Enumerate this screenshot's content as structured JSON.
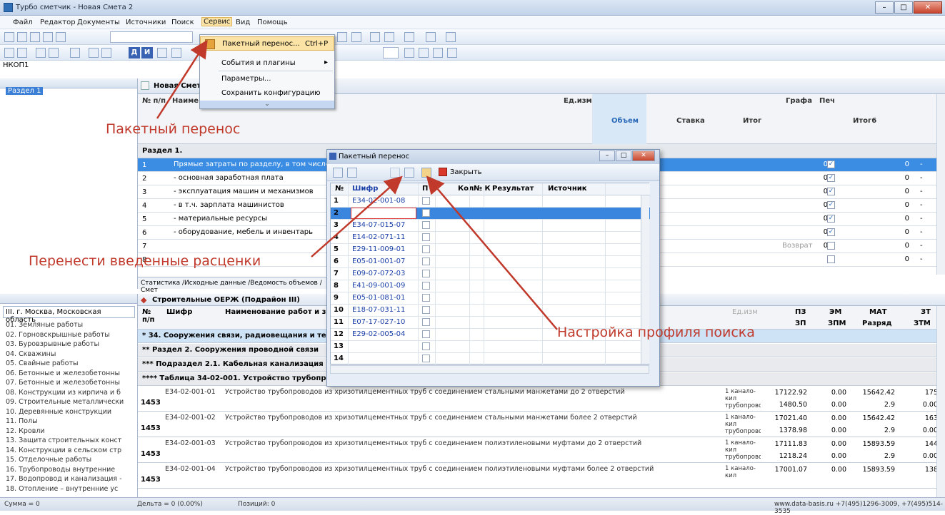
{
  "window": {
    "title": "Турбо сметчик - Новая Смета 2"
  },
  "menu": [
    "Файл",
    "Редактор",
    "Документы",
    "Источники",
    "Поиск",
    "Сервис",
    "Вид",
    "Помощь"
  ],
  "hkof": "НКОП1",
  "tree_top": {
    "selected": "Раздел 1"
  },
  "dropdown": {
    "items": [
      {
        "label": "Пакетный перенос...",
        "shortcut": "Ctrl+P"
      },
      {
        "label": "События и плагины"
      },
      {
        "label": "Параметры..."
      },
      {
        "label": "Сохранить конфигурацию"
      }
    ],
    "expand_glyph": "⌄"
  },
  "estimate": {
    "tab": "Новая Смета",
    "headers": {
      "np": "№ п/п",
      "name": "Наиме",
      "unit": "Ед.изм.",
      "volume": "Объем",
      "rate": "Ставка",
      "total": "Итог",
      "grafa": "Графа",
      "pech": "Печ",
      "total6": "Итог6"
    },
    "section": "Раздел 1.",
    "rows": [
      {
        "n": "1",
        "text": "Прямые затраты по разделу, в том числе:",
        "v": "0",
        "chk": "✓",
        "v2": "0",
        "d": "-",
        "sel": true
      },
      {
        "n": "2",
        "text": "- основная заработная плата",
        "v": "0",
        "chk": "✓",
        "v2": "0",
        "d": "-"
      },
      {
        "n": "3",
        "text": "- эксплуатация машин и механизмов",
        "v": "0",
        "chk": "✓",
        "v2": "0",
        "d": "-"
      },
      {
        "n": "4",
        "text": "- в т.ч. зарплата машинистов",
        "v": "0",
        "chk": "✓",
        "v2": "0",
        "d": "-"
      },
      {
        "n": "5",
        "text": "- материальные ресурсы",
        "v": "0",
        "chk": "✓",
        "v2": "0",
        "d": "-"
      },
      {
        "n": "6",
        "text": "- оборудование, мебель и инвентарь",
        "v": "0",
        "chk": "✓",
        "v2": "0",
        "d": "-"
      },
      {
        "n": "7",
        "text": "",
        "v": "0",
        "vextra": "Возврат",
        "chk": "",
        "v2": "0",
        "d": "-"
      },
      {
        "n": "8",
        "text": "",
        "v": "",
        "chk": "",
        "v2": "0",
        "d": "-"
      }
    ],
    "bottom_tabs": "Статистика /Исходные данные /Ведомость объемов /Смет"
  },
  "norms": {
    "region": "III. г. Москва, Московская область",
    "tree": [
      "01. Земляные работы",
      "02. Горновскрышные работы",
      "03. Буровзрывные работы",
      "04. Скважины",
      "05. Свайные работы",
      "06. Бетонные и железобетонны",
      "07. Бетонные и железобетонны",
      "08. Конструкции из кирпича и б",
      "09. Строительные металлически",
      "10. Деревянные конструкции",
      "11. Полы",
      "12. Кровли",
      "13. Защита строительных конст",
      "14. Конструкции в сельском стр",
      "15. Отделочные работы",
      "16. Трубопроводы внутренние",
      "17. Водопровод и канализация -",
      "18. Отопление – внутренние ус"
    ],
    "tab": "Строительные ОЕРЖ (Подрайон III)",
    "headers": {
      "np": "№ п/п",
      "code": "Шифр",
      "name": "Наименование работ и зат",
      "unit": "Ед.изм",
      "pz": "ПЗ",
      "zp": "ЗП",
      "em": "ЭМ",
      "zpm": "ЗПМ",
      "mat": "МАТ",
      "razr": "Разряд",
      "zt": "ЗТ",
      "ztm": "ЗТМ"
    },
    "group_rows": [
      "* 34. Сооружения связи, радиовещания и телев",
      "** Раздел 2. Сооружения проводной связи",
      "*** Подраздел 2.1. Кабельная канализация",
      "**** Таблица 34-02-001. Устройство трубопроводов из хризотилцементных труб"
    ],
    "rows": [
      {
        "num": "1453",
        "code": "Е34-02-001-01",
        "name": "Устройство трубопроводов из хризотилцементных труб с соединением стальными манжетами до 2 отверстий",
        "unit": "1 канало-кил трубопровс",
        "a1": "17122.92",
        "a2": "0.00",
        "a3": "15642.42",
        "a4": "175",
        "b1": "1480.50",
        "b2": "0.00",
        "b3": "2.9",
        "b4": "0.00"
      },
      {
        "num": "1453",
        "code": "Е34-02-001-02",
        "name": "Устройство трубопроводов из хризотилцементных труб с соединением стальными манжетами более 2 отверстий",
        "unit": "1 канало-кил трубопровс",
        "a1": "17021.40",
        "a2": "0.00",
        "a3": "15642.42",
        "a4": "163",
        "b1": "1378.98",
        "b2": "0.00",
        "b3": "2.9",
        "b4": "0.00"
      },
      {
        "num": "1453",
        "code": "Е34-02-001-03",
        "name": "Устройство трубопроводов из хризотилцементных труб с соединением полиэтиленовыми муфтами до 2 отверстий",
        "unit": "1 канало-кил трубопровс",
        "a1": "17111.83",
        "a2": "0.00",
        "a3": "15893.59",
        "a4": "144",
        "b1": "1218.24",
        "b2": "0.00",
        "b3": "2.9",
        "b4": "0.00"
      },
      {
        "num": "1453",
        "code": "Е34-02-001-04",
        "name": "Устройство трубопроводов из хризотилцементных труб с соединением полиэтиленовыми муфтами более 2 отверстий",
        "unit": "1 канало-кил",
        "a1": "17001.07",
        "a2": "0.00",
        "a3": "15893.59",
        "a4": "138",
        "b1": "",
        "b2": "",
        "b3": "",
        "b4": ""
      }
    ]
  },
  "dialog": {
    "title": "Пакетный перенос",
    "close_label": "Закрыть",
    "headers": {
      "n": "№",
      "code": "Шифр",
      "p": "П",
      "kol": "Кол",
      "nk": "№ К",
      "res": "Результат",
      "src": "Источник"
    },
    "rows": [
      {
        "n": "1",
        "code": "Е34-02-001-08"
      },
      {
        "n": "2",
        "code": "",
        "sel": true
      },
      {
        "n": "3",
        "code": "Е34-07-015-07"
      },
      {
        "n": "4",
        "code": "Е14-02-071-11"
      },
      {
        "n": "5",
        "code": "Е29-11-009-01"
      },
      {
        "n": "6",
        "code": "Е05-01-001-07"
      },
      {
        "n": "7",
        "code": "Е09-07-072-03"
      },
      {
        "n": "8",
        "code": "Е41-09-001-09"
      },
      {
        "n": "9",
        "code": "Е05-01-081-01"
      },
      {
        "n": "10",
        "code": "Е18-07-031-11"
      },
      {
        "n": "11",
        "code": "Е07-17-027-10"
      },
      {
        "n": "12",
        "code": "Е29-02-005-04"
      },
      {
        "n": "13",
        "code": ""
      },
      {
        "n": "14",
        "code": ""
      }
    ]
  },
  "annotations": {
    "batch": "Пакетный перенос",
    "transfer": "Перенести введенные расценки",
    "profile": "Настройка профиля поиска"
  },
  "status": {
    "sum": "Сумма = 0",
    "delta": "Дельта = 0 (0.00%)",
    "rows": "Позиций: 0",
    "contact": "www.data-basis.ru  +7(495)1296-3009, +7(495)514-3535"
  },
  "colors": {
    "annotation": "#c0392b",
    "selection": "#3b8de3",
    "menu_highlight": "#fbe3a6"
  }
}
